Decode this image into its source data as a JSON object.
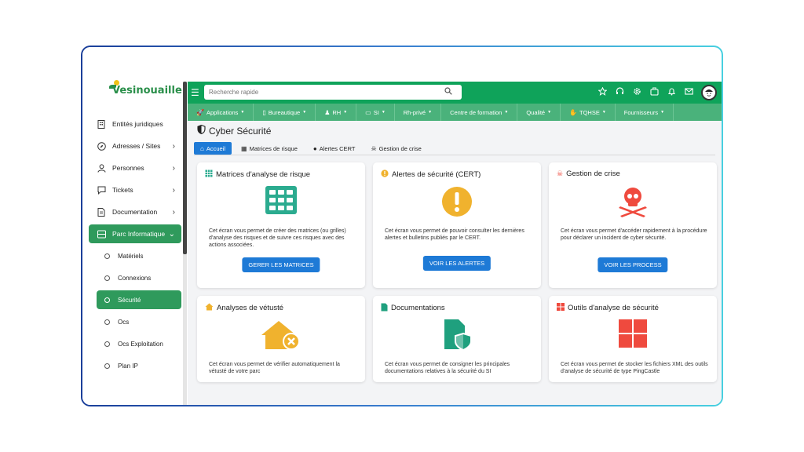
{
  "sidebar": {
    "logo": "Vesinouaille",
    "items": [
      {
        "label": "Entités juridiques",
        "icon": "building-icon",
        "chevron": false
      },
      {
        "label": "Adresses / Sites",
        "icon": "compass-icon",
        "chevron": true
      },
      {
        "label": "Personnes",
        "icon": "person-icon",
        "chevron": true
      },
      {
        "label": "Tickets",
        "icon": "chat-icon",
        "chevron": true
      },
      {
        "label": "Documentation",
        "icon": "document-icon",
        "chevron": true
      },
      {
        "label": "Parc Informatique",
        "icon": "server-icon",
        "chevron": true,
        "active": true
      }
    ],
    "subitems": [
      {
        "label": "Matériels"
      },
      {
        "label": "Connexions"
      },
      {
        "label": "Sécurité",
        "active": true
      },
      {
        "label": "Ocs"
      },
      {
        "label": "Ocs Exploitation"
      },
      {
        "label": "Plan IP"
      }
    ]
  },
  "topbar": {
    "search_placeholder": "Recherche rapide",
    "icons": [
      "star-icon",
      "headset-icon",
      "gear-icon",
      "briefcase-icon",
      "bell-icon",
      "mail-icon",
      "avatar"
    ]
  },
  "menubar": [
    {
      "label": "Applications",
      "icon": "rocket-icon"
    },
    {
      "label": "Bureautique",
      "icon": "file-icon"
    },
    {
      "label": "RH",
      "icon": "people-icon"
    },
    {
      "label": "SI",
      "icon": "monitor-icon"
    },
    {
      "label": "Rh-privé",
      "icon": ""
    },
    {
      "label": "Centre de formation",
      "icon": ""
    },
    {
      "label": "Qualité",
      "icon": ""
    },
    {
      "label": "TQHSE",
      "icon": "hand-icon"
    },
    {
      "label": "Fournisseurs",
      "icon": ""
    }
  ],
  "page": {
    "title": "Cyber Sécurité",
    "tabs": [
      {
        "label": "Accueil",
        "icon": "home-icon",
        "active": true
      },
      {
        "label": "Matrices de risque",
        "icon": "grid-icon"
      },
      {
        "label": "Alertes CERT",
        "icon": "alert-icon"
      },
      {
        "label": "Gestion de crise",
        "icon": "skull-icon"
      }
    ]
  },
  "cards": [
    {
      "title": "Matrices d'analyse de risque",
      "text": "Cet écran vous permet de créer des matrices (ou grilles) d'analyse des risques et de suivre ces risques avec des actions associées.",
      "button": "GERER LES MATRICES",
      "color": "#2bab8f"
    },
    {
      "title": "Alertes de sécurité (CERT)",
      "text": "Cet écran vous permet de pouvoir consulter les dernières alertes et bulletins publiés par le CERT.",
      "button": "VOIR LES ALERTES",
      "color": "#f0b22e"
    },
    {
      "title": "Gestion de crise",
      "text": "Cet écran vous permet d'accéder rapidement à la procédure pour déclarer un incident de cyber sécurité.",
      "button": "VOIR LES PROCESS",
      "color": "#ef4a3e"
    },
    {
      "title": "Analyses de vétusté",
      "text": "Cet écran vous permet de vérifier automatiquement la vétusté de votre parc",
      "color": "#f0b22e"
    },
    {
      "title": "Documentations",
      "text": "Cet écran vous permet de consigner les principales documentations relatives à la sécurité du SI",
      "color": "#1fa07e"
    },
    {
      "title": "Outils d'analyse de sécurité",
      "text": "Cet écran vous permet de stocker les fichiers XML des outils d'analyse de sécurité de type PingCastle",
      "color": "#ef4a3e"
    }
  ]
}
